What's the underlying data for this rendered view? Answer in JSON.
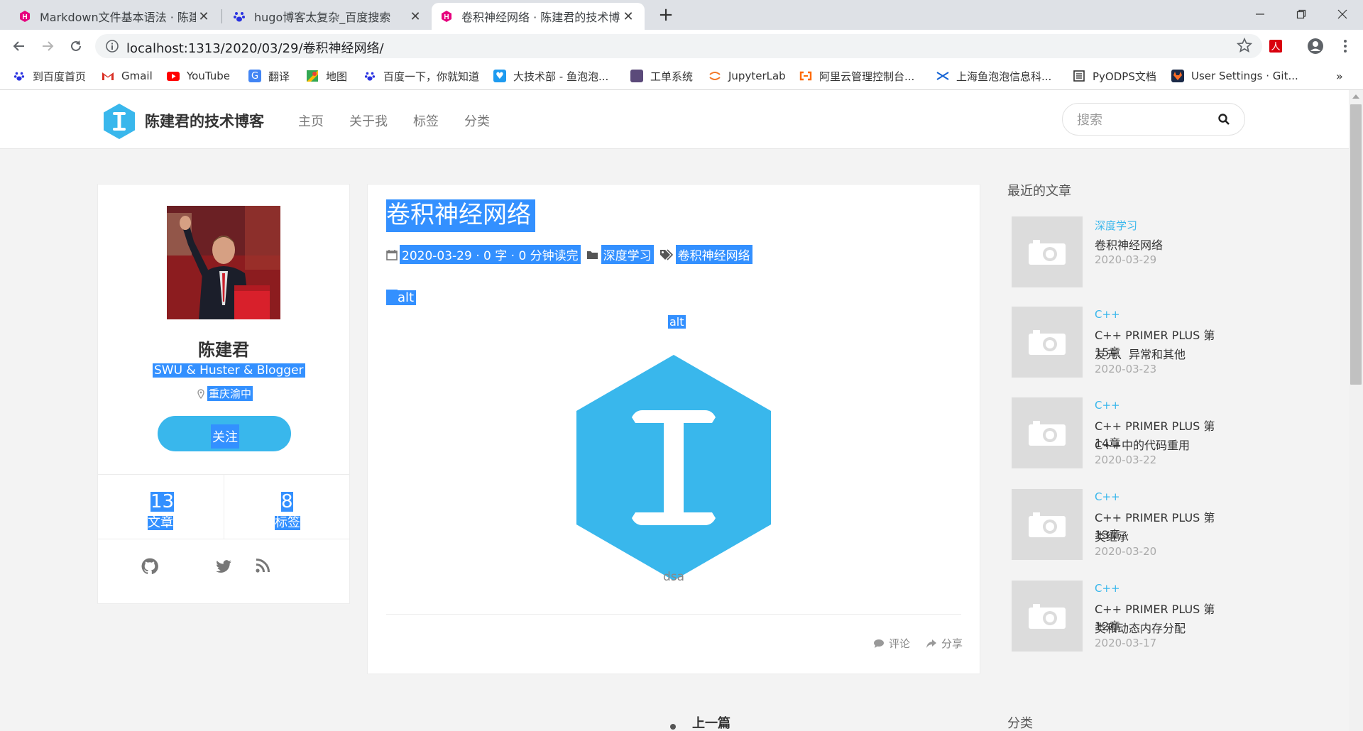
{
  "browser": {
    "tabs": [
      {
        "title": "Markdown文件基本语法 · 陈建君",
        "icon": "hugo-icon",
        "active": false
      },
      {
        "title": "hugo博客太复杂_百度搜索",
        "icon": "baidu-paw-icon",
        "active": false
      },
      {
        "title": "卷积神经网络 · 陈建君的技术博客",
        "icon": "hugo-icon",
        "active": true
      }
    ],
    "url": "localhost:1313/2020/03/29/卷积神经网络/",
    "bookmarks": [
      {
        "label": "到百度首页",
        "icon": "baidu-paw-icon"
      },
      {
        "label": "Gmail",
        "icon": "gmail-icon"
      },
      {
        "label": "YouTube",
        "icon": "youtube-icon"
      },
      {
        "label": "翻译",
        "icon": "translate-icon"
      },
      {
        "label": "地图",
        "icon": "maps-icon"
      },
      {
        "label": "百度一下，你就知道",
        "icon": "baidu-paw-icon"
      },
      {
        "label": "大技术部 - 鱼泡泡...",
        "icon": "chat-icon"
      },
      {
        "label": "工单系统",
        "icon": "ticket-icon"
      },
      {
        "label": "JupyterLab",
        "icon": "jupyter-icon"
      },
      {
        "label": "阿里云管理控制台...",
        "icon": "aliyun-icon"
      },
      {
        "label": "上海鱼泡泡信息科...",
        "icon": "confluence-icon"
      },
      {
        "label": "PyODPS文档",
        "icon": "docs-icon"
      },
      {
        "label": "User Settings · Git...",
        "icon": "gitlab-icon"
      }
    ]
  },
  "site": {
    "title": "陈建君的技术博客",
    "menu": [
      "主页",
      "关于我",
      "标签",
      "分类"
    ],
    "search_placeholder": "搜索"
  },
  "profile": {
    "name": "陈建君",
    "bio": "SWU & Huster & Blogger",
    "location": "重庆渝中",
    "follow_label": "关注",
    "posts_count": "13",
    "posts_label": "文章",
    "tags_count": "8",
    "tags_label": "标签",
    "social_icons": [
      "github-icon",
      "twitter-icon",
      "rss-icon"
    ]
  },
  "article": {
    "title": "卷积神经网络",
    "meta": "2020-03-29 · 0 字 · 0 分钟读完",
    "category": "深度学习",
    "tag": "卷积神经网络",
    "image_alt_1": "alt",
    "image_alt_2": "alt",
    "caption": "dsa",
    "comment_label": "评论",
    "share_label": "分享"
  },
  "sidebar": {
    "recent_heading": "最近的文章",
    "recent": [
      {
        "category": "深度学习",
        "line1": "卷积神经网络",
        "line2": "",
        "date": "2020-03-29"
      },
      {
        "category": "C++",
        "line1": "C++ PRIMER PLUS 第15章",
        "line2": "友元、异常和其他",
        "date": "2020-03-23"
      },
      {
        "category": "C++",
        "line1": "C++ PRIMER PLUS 第14章",
        "line2": "C++中的代码重用",
        "date": "2020-03-22"
      },
      {
        "category": "C++",
        "line1": "C++ PRIMER PLUS 第13章",
        "line2": "类继承",
        "date": "2020-03-20"
      },
      {
        "category": "C++",
        "line1": "C++ PRIMER PLUS 第12章",
        "line2": "类和动态内存分配",
        "date": "2020-03-17"
      }
    ],
    "categories_heading": "分类"
  },
  "pager": {
    "prev_label": "上一篇"
  },
  "colors": {
    "accent": "#39b7ec",
    "selection": "#3390ff"
  }
}
